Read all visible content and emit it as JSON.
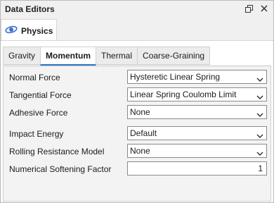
{
  "window": {
    "title": "Data Editors"
  },
  "titlebar_icons": [
    "restore-icon",
    "close-icon"
  ],
  "physics_tab": {
    "label": "Physics",
    "icon": "physics-orbit-icon",
    "icon_color": "#3a6fd0"
  },
  "tabs": [
    {
      "label": "Gravity",
      "active": false
    },
    {
      "label": "Momentum",
      "active": true
    },
    {
      "label": "Thermal",
      "active": false
    },
    {
      "label": "Coarse-Graining",
      "active": false
    }
  ],
  "fields": {
    "normal_force": {
      "label": "Normal Force",
      "value": "Hysteretic Linear Spring"
    },
    "tangential_force": {
      "label": "Tangential Force",
      "value": "Linear Spring Coulomb Limit"
    },
    "adhesive_force": {
      "label": "Adhesive Force",
      "value": "None"
    },
    "impact_energy": {
      "label": "Impact Energy",
      "value": "Default"
    },
    "rolling_resistance": {
      "label": "Rolling Resistance Model",
      "value": "None"
    },
    "softening_factor": {
      "label": "Numerical Softening Factor",
      "value": "1"
    }
  },
  "colors": {
    "active_tab_underline": "#2f79c9",
    "panel_bg": "#f3f3f3"
  }
}
